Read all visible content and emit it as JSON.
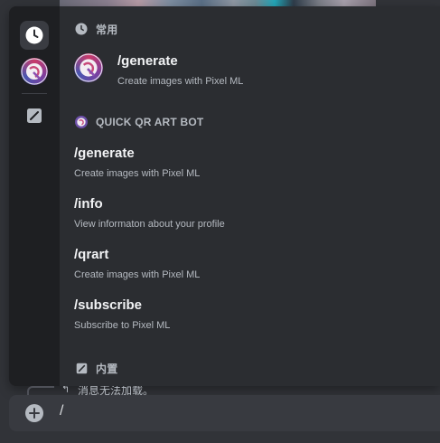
{
  "rail": {
    "items": [
      {
        "icon": "clock-icon"
      },
      {
        "icon": "bot-avatar-icon"
      },
      {
        "icon": "builtin-icon"
      }
    ]
  },
  "sections": {
    "frequent": {
      "title": "常用",
      "icon": "clock-icon"
    },
    "bot": {
      "title": "QUICK QR ART BOT",
      "icon": "bot-avatar-icon"
    },
    "builtin": {
      "title": "内置",
      "icon": "builtin-icon"
    }
  },
  "frequent_commands": [
    {
      "name": "/generate",
      "description": "Create images with Pixel ML"
    }
  ],
  "bot_commands": [
    {
      "name": "/generate",
      "description": "Create images with Pixel ML"
    },
    {
      "name": "/info",
      "description": "View informaton about your profile"
    },
    {
      "name": "/qrart",
      "description": "Create images with Pixel ML"
    },
    {
      "name": "/subscribe",
      "description": "Subscribe to Pixel ML"
    }
  ],
  "reply_preview": "消息无法加载。",
  "chat_input": {
    "value": "/"
  },
  "colors": {
    "background": "#313338",
    "popup": "#2b2d31",
    "rail": "#1e1f22",
    "text_muted": "#b5bac1",
    "input": "#383a40"
  }
}
